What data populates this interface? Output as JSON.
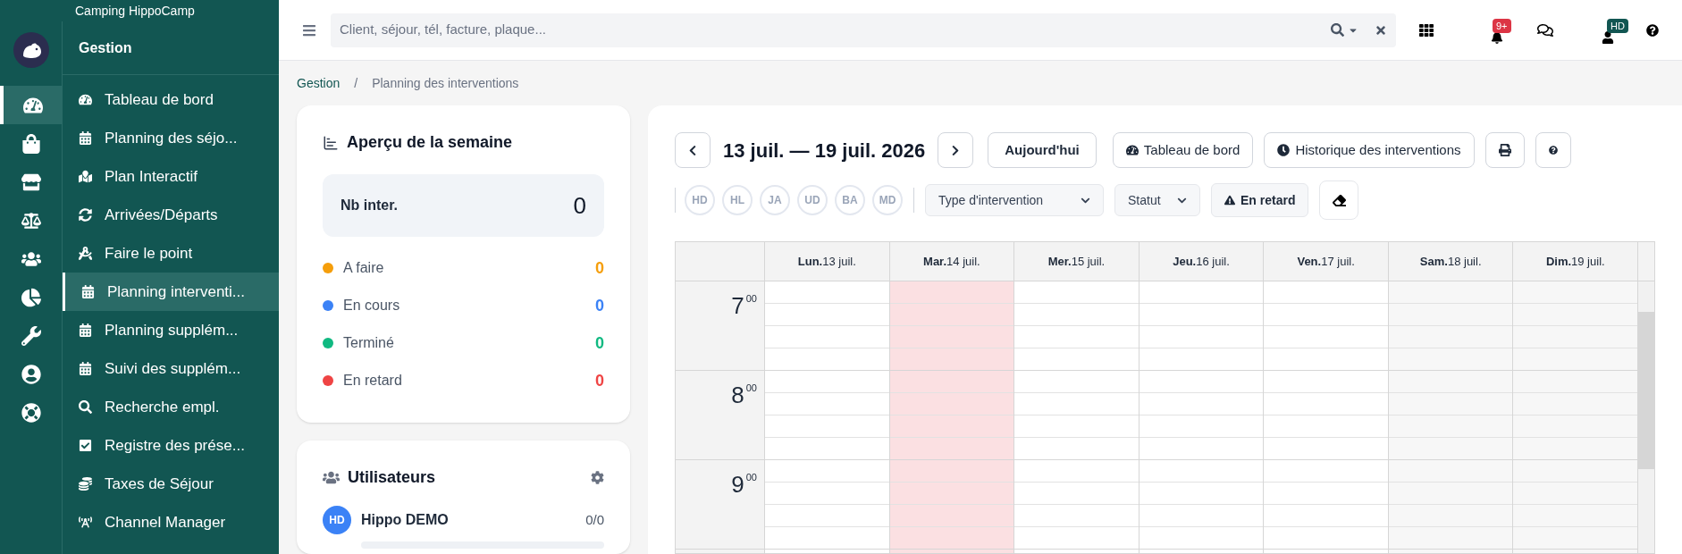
{
  "brand": {
    "name": "Camping HippoCamp"
  },
  "rail": [
    {
      "selected": true
    },
    {
      "selected": false
    },
    {
      "selected": false
    },
    {
      "selected": false
    },
    {
      "selected": false
    },
    {
      "selected": false
    },
    {
      "selected": false
    },
    {
      "selected": false
    },
    {
      "selected": false
    }
  ],
  "sidebar": {
    "title": "Gestion",
    "items": [
      {
        "label": "Tableau de bord",
        "selected": false
      },
      {
        "label": "Planning des séjo...",
        "selected": false
      },
      {
        "label": "Plan Interactif",
        "selected": false
      },
      {
        "label": "Arrivées/Départs",
        "selected": false
      },
      {
        "label": "Faire le point",
        "selected": false
      },
      {
        "label": "Planning interventi...",
        "selected": true
      },
      {
        "label": "Planning supplém...",
        "selected": false
      },
      {
        "label": "Suivi des supplém...",
        "selected": false
      },
      {
        "label": "Recherche empl.",
        "selected": false
      },
      {
        "label": "Registre des prése...",
        "selected": false
      },
      {
        "label": "Taxes de Séjour",
        "selected": false
      },
      {
        "label": "Channel Manager",
        "selected": false
      }
    ]
  },
  "topbar": {
    "search": {
      "placeholder": "Client, séjour, tél, facture, plaque..."
    },
    "notifications_badge": "9+",
    "user_badge": "HD"
  },
  "breadcrumb_separator": "/",
  "breadcrumb": [
    {
      "label": "Gestion",
      "kind": "link"
    },
    {
      "label": "Planning des interventions",
      "kind": "current"
    }
  ],
  "week_overview": {
    "title": "Aperçu de la semaine",
    "total": {
      "label": "Nb inter.",
      "value": "0"
    },
    "statuses": [
      {
        "label": "A faire",
        "value": "0",
        "color": "#f59e0b"
      },
      {
        "label": "En cours",
        "value": "0",
        "color": "#3b82f6"
      },
      {
        "label": "Terminé",
        "value": "0",
        "color": "#10b981"
      },
      {
        "label": "En retard",
        "value": "0",
        "color": "#ef4444"
      }
    ]
  },
  "users": {
    "title": "Utilisateurs",
    "items": [
      {
        "initials": "HD",
        "name": "Hippo DEMO",
        "count": "0/0",
        "level": 0
      }
    ]
  },
  "calendar": {
    "range": "13 juil. — 19 juil. 2026",
    "today_button": "Aujourd'hui",
    "dashboard_button": "Tableau de bord",
    "history_button": "Historique des interventions",
    "people": [
      {
        "initials": "HD",
        "selected": false
      },
      {
        "initials": "HL",
        "selected": false
      },
      {
        "initials": "JA",
        "selected": false
      },
      {
        "initials": "UD",
        "selected": false
      },
      {
        "initials": "BA",
        "selected": false
      },
      {
        "initials": "MD",
        "selected": false
      }
    ],
    "type_select": "Type d'intervention",
    "status_select": "Statut",
    "late_button": "En retard",
    "days": [
      {
        "name": "Lun.",
        "date": "13 juil.",
        "kind": "weekday"
      },
      {
        "name": "Mar.",
        "date": "14 juil.",
        "kind": "today"
      },
      {
        "name": "Mer.",
        "date": "15 juil.",
        "kind": "weekday"
      },
      {
        "name": "Jeu.",
        "date": "16 juil.",
        "kind": "weekday"
      },
      {
        "name": "Ven.",
        "date": "17 juil.",
        "kind": "weekday"
      },
      {
        "name": "Sam.",
        "date": "18 juil.",
        "kind": "weekend"
      },
      {
        "name": "Dim.",
        "date": "19 juil.",
        "kind": "weekend"
      }
    ],
    "hours": [
      {
        "hour": "7",
        "minutes": "00"
      },
      {
        "hour": "8",
        "minutes": "00"
      },
      {
        "hour": "9",
        "minutes": "00"
      }
    ]
  }
}
